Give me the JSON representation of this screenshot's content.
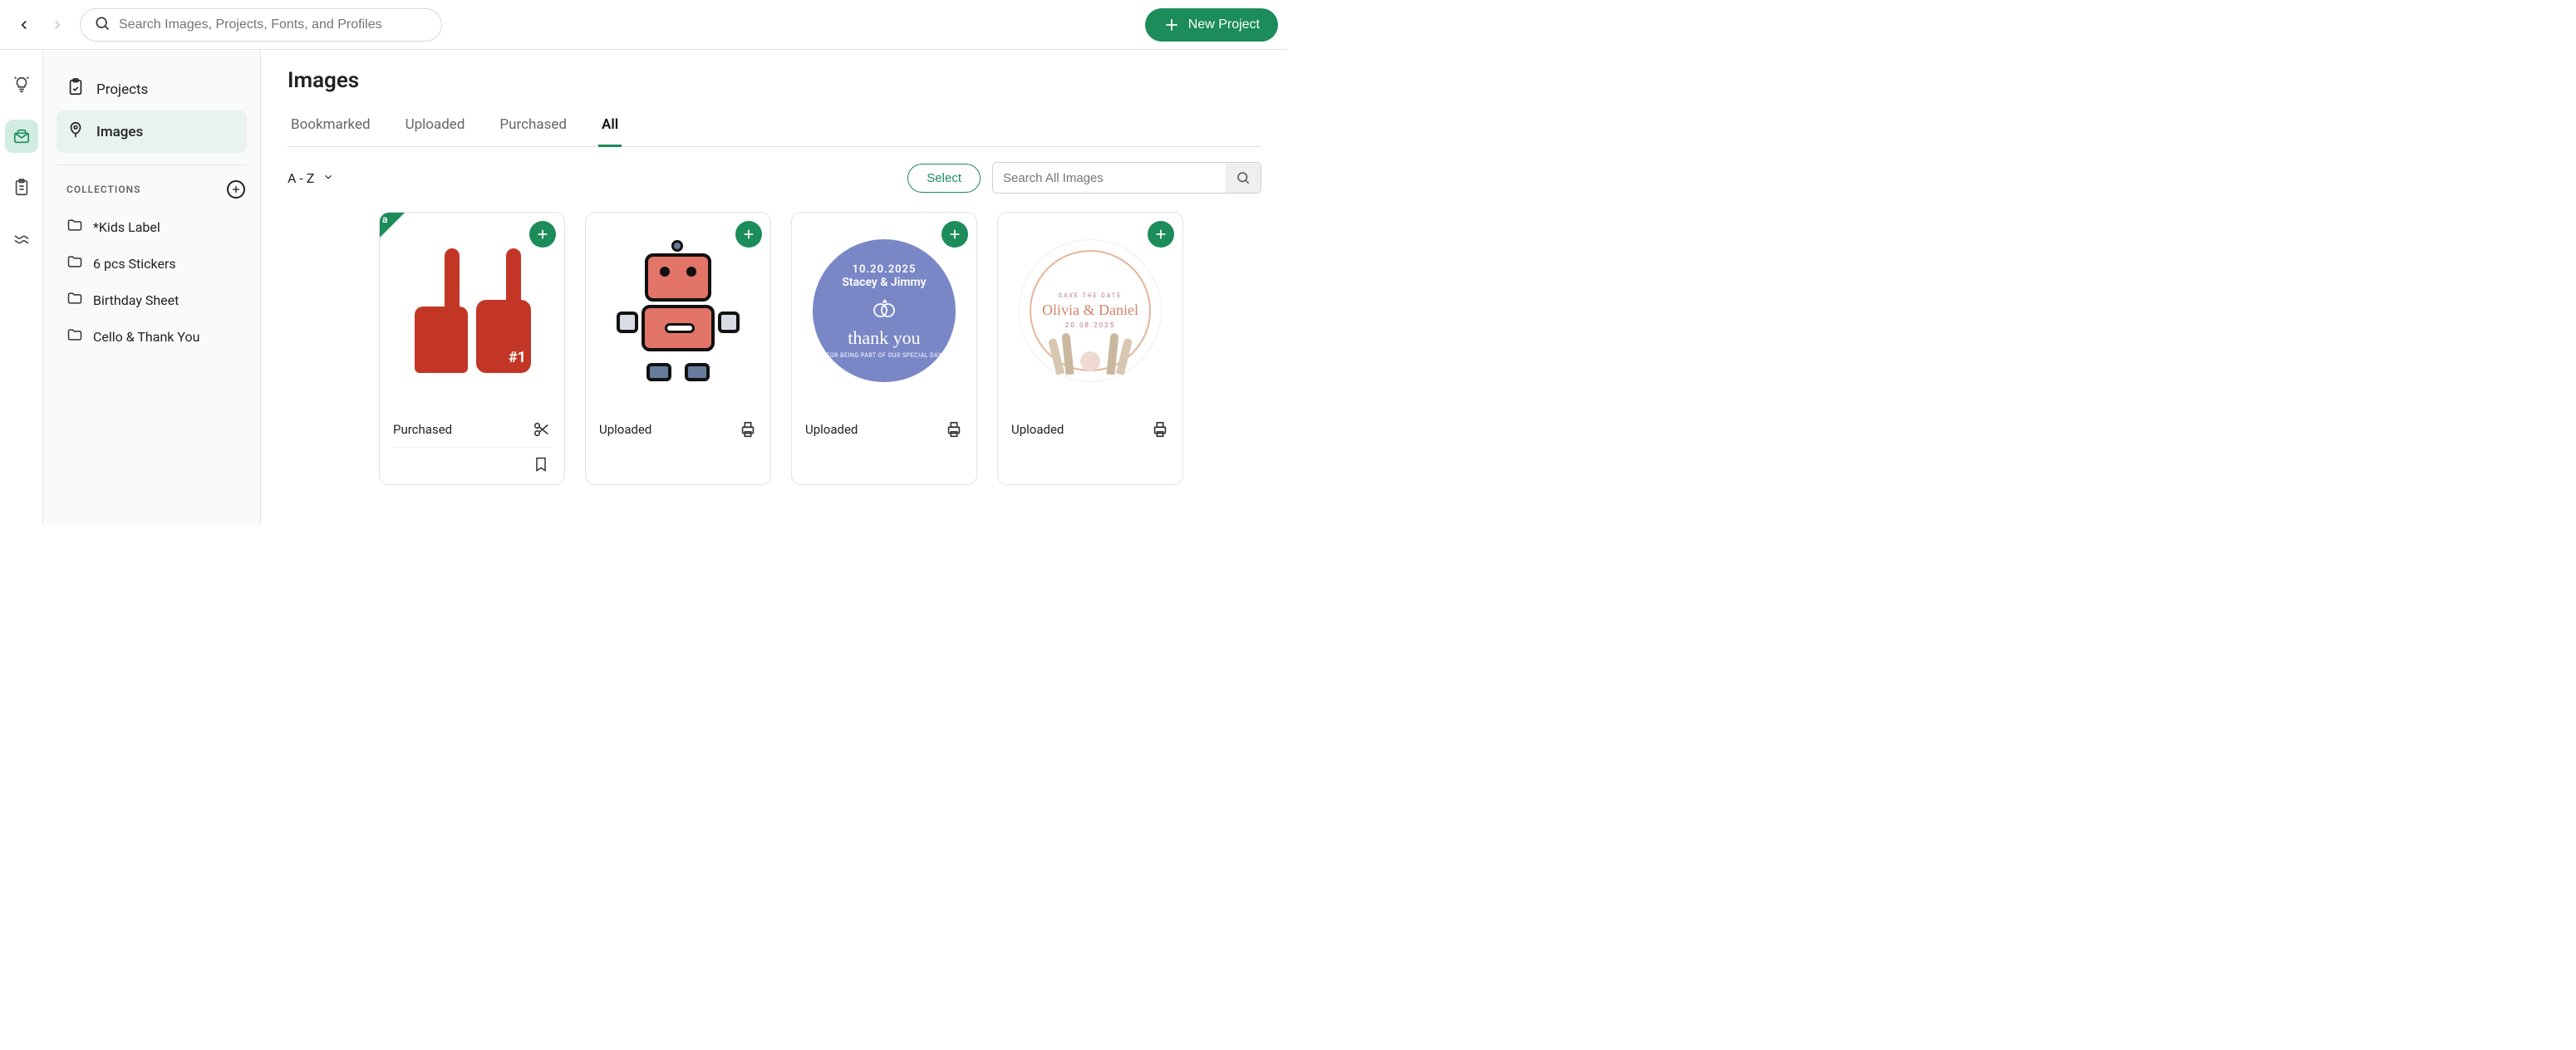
{
  "header": {
    "search_placeholder": "Search Images, Projects, Fonts, and Profiles",
    "new_project_label": "New Project"
  },
  "sidebar": {
    "nav": {
      "projects": "Projects",
      "images": "Images"
    },
    "collections_label": "COLLECTIONS",
    "collections": [
      {
        "label": "*Kids Label"
      },
      {
        "label": "6 pcs Stickers"
      },
      {
        "label": "Birthday Sheet"
      },
      {
        "label": "Cello & Thank You"
      }
    ]
  },
  "main": {
    "title": "Images",
    "tabs": {
      "bookmarked": "Bookmarked",
      "uploaded": "Uploaded",
      "purchased": "Purchased",
      "all": "All"
    },
    "sort_label": "A - Z",
    "select_label": "Select",
    "search_placeholder": "Search All Images",
    "cards": [
      {
        "status": "Purchased",
        "corner": "a"
      },
      {
        "status": "Uploaded"
      },
      {
        "status": "Uploaded",
        "sticker": {
          "date": "10.20.2025",
          "names": "Stacey & Jimmy",
          "thank": "thank you",
          "sub": "FOR BEING PART OF OUR SPECIAL DAY"
        }
      },
      {
        "status": "Uploaded",
        "boho": {
          "std": "SAVE THE DATE",
          "names": "Olivia & Daniel",
          "date": "20.08.2025"
        }
      }
    ]
  },
  "colors": {
    "accent": "#1b8c5a"
  }
}
